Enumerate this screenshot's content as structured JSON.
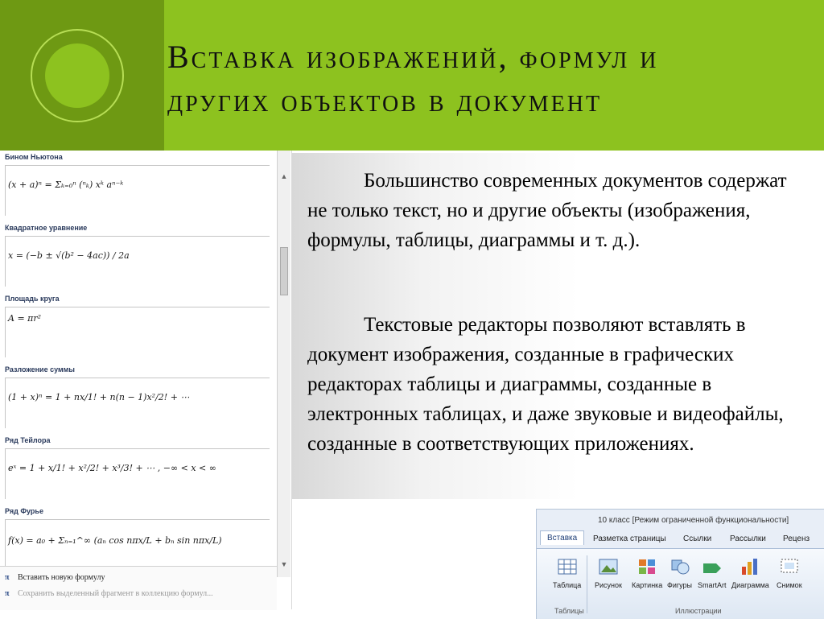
{
  "slide": {
    "title_line1": "Вставка изображений, формул и",
    "title_line2": "других объектов в документ",
    "paragraph1": "Большинство современных документов содержат не только текст, но и другие объекты (изображения, формулы, таблицы, диаграммы и т. д.).",
    "paragraph2": "Текстовые редакторы позволяют вставлять в документ изображения, созданные в графических редакторах таблицы и диаграммы, созданные в электронных таблицах, и даже звуковые и видеофайлы, созданные в соответствующих приложениях."
  },
  "colors": {
    "header_green": "#8dc21f",
    "header_dark_green": "#6e9913"
  },
  "formula_panel": {
    "items": [
      {
        "title": "Бином Ньютона",
        "formula": "(x + a)ⁿ = Σₖ₌₀ⁿ (ⁿₖ) xᵏ aⁿ⁻ᵏ"
      },
      {
        "title": "Квадратное уравнение",
        "formula": "x = (−b ± √(b² − 4ac)) / 2a"
      },
      {
        "title": "Площадь круга",
        "formula": "A = πr²"
      },
      {
        "title": "Разложение суммы",
        "formula": "(1 + x)ⁿ = 1 + nx/1! + n(n − 1)x²/2! + ⋯"
      },
      {
        "title": "Ряд Тейлора",
        "formula": "eˣ = 1 + x/1! + x²/2! + x³/3! + ⋯ ,    −∞ < x < ∞"
      },
      {
        "title": "Ряд Фурье",
        "formula": "f(x) = a₀ + Σₙ₌₁^∞ (aₙ cos nπx/L + bₙ sin nπx/L)"
      }
    ],
    "insert_new": "Вставить новую формулу",
    "save_selection": "Сохранить выделенный фрагмент в коллекцию формул..."
  },
  "ribbon": {
    "window_title": "10 класс [Режим ограниченной функциональности]",
    "tabs": [
      "Вставка",
      "Разметка страницы",
      "Ссылки",
      "Рассылки",
      "Реценз"
    ],
    "buttons": [
      "Таблица",
      "Рисунок",
      "Картинка",
      "Фигуры",
      "SmartArt",
      "Диаграмма",
      "Снимок"
    ],
    "groups": [
      "Таблицы",
      "Иллюстрации"
    ]
  }
}
